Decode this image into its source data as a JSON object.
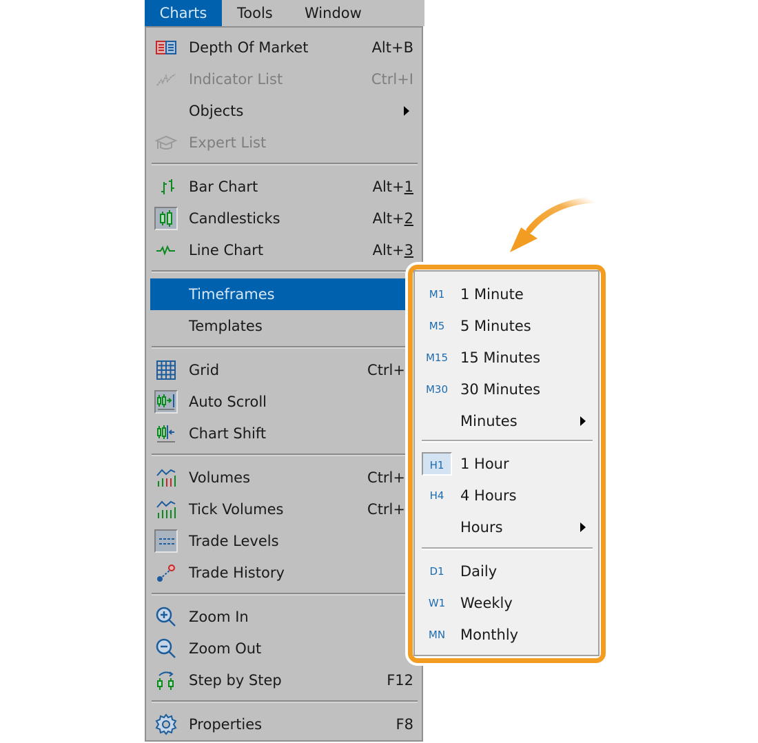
{
  "menubar": {
    "items": [
      {
        "label": "Charts",
        "active": true
      },
      {
        "label": "Tools",
        "active": false
      },
      {
        "label": "Window",
        "active": false
      }
    ]
  },
  "charts_menu": {
    "items": [
      {
        "label": "Depth Of Market",
        "shortcut": "Alt+B",
        "icon": "depth-of-market-icon",
        "disabled": false
      },
      {
        "label": "Indicator List",
        "shortcut": "Ctrl+I",
        "icon": "indicator-list-icon",
        "disabled": true
      },
      {
        "label": "Objects",
        "shortcut": "",
        "icon": "",
        "submenu": true
      },
      {
        "label": "Expert List",
        "shortcut": "",
        "icon": "expert-list-icon",
        "disabled": true
      },
      {
        "label": "Bar Chart",
        "shortcut_prefix": "Alt+",
        "shortcut_key": "1",
        "icon": "bar-chart-icon"
      },
      {
        "label": "Candlesticks",
        "shortcut_prefix": "Alt+",
        "shortcut_key": "2",
        "icon": "candlesticks-icon",
        "checked": true
      },
      {
        "label": "Line Chart",
        "shortcut_prefix": "Alt+",
        "shortcut_key": "3",
        "icon": "line-chart-icon"
      },
      {
        "label": "Timeframes",
        "icon": "",
        "highlighted": true,
        "submenu": true
      },
      {
        "label": "Templates",
        "icon": "",
        "submenu": true
      },
      {
        "label": "Grid",
        "shortcut": "Ctrl+",
        "icon": "grid-icon"
      },
      {
        "label": "Auto Scroll",
        "shortcut": "",
        "icon": "auto-scroll-icon",
        "checked": true
      },
      {
        "label": "Chart Shift",
        "shortcut": "",
        "icon": "chart-shift-icon"
      },
      {
        "label": "Volumes",
        "shortcut": "Ctrl+",
        "icon": "volumes-icon"
      },
      {
        "label": "Tick Volumes",
        "shortcut": "Ctrl+",
        "icon": "tick-volumes-icon"
      },
      {
        "label": "Trade Levels",
        "shortcut": "",
        "icon": "trade-levels-icon",
        "checked": true
      },
      {
        "label": "Trade History",
        "shortcut": "",
        "icon": "trade-history-icon"
      },
      {
        "label": "Zoom In",
        "shortcut": "",
        "icon": "zoom-in-icon"
      },
      {
        "label": "Zoom Out",
        "shortcut": "",
        "icon": "zoom-out-icon"
      },
      {
        "label": "Step by Step",
        "shortcut": "F12",
        "icon": "step-by-step-icon"
      },
      {
        "label": "Properties",
        "shortcut": "F8",
        "icon": "properties-gear-icon"
      }
    ]
  },
  "timeframes_submenu": {
    "items": [
      {
        "code": "M1",
        "label": "1 Minute"
      },
      {
        "code": "M5",
        "label": "5 Minutes"
      },
      {
        "code": "M15",
        "label": "15 Minutes"
      },
      {
        "code": "M30",
        "label": "30 Minutes"
      },
      {
        "code": "",
        "label": "Minutes",
        "submenu": true
      },
      {
        "code": "H1",
        "label": "1 Hour",
        "checked": true
      },
      {
        "code": "H4",
        "label": "4 Hours"
      },
      {
        "code": "",
        "label": "Hours",
        "submenu": true
      },
      {
        "code": "D1",
        "label": "Daily"
      },
      {
        "code": "W1",
        "label": "Weekly"
      },
      {
        "code": "MN",
        "label": "Monthly"
      }
    ]
  },
  "colors": {
    "highlight": "#0061af",
    "menu_bg": "#c0c0c0",
    "submenu_bg": "#f0f0f0",
    "callout_orange": "#f39c22",
    "icon_green": "#0a8a1e",
    "icon_blue": "#1c5c9c"
  }
}
